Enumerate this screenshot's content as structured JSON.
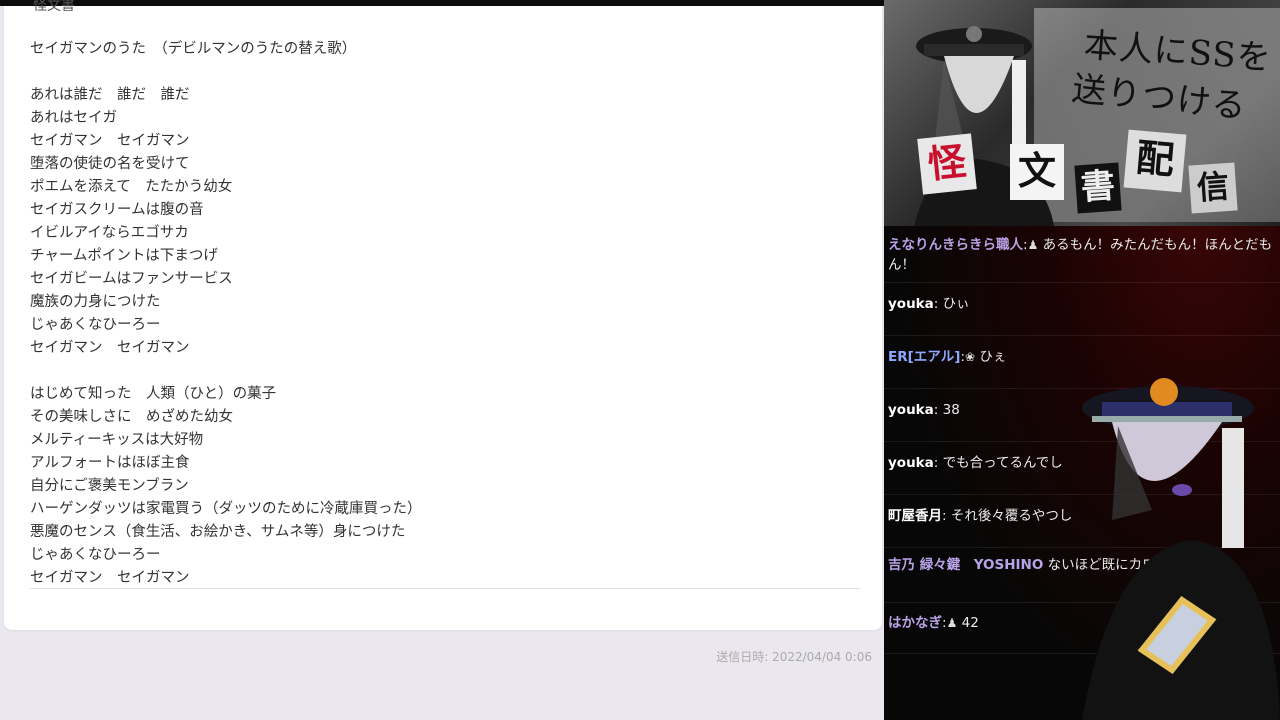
{
  "letter": {
    "clipped_title": "怪文書",
    "lines": [
      "セイガマンのうた　（デビルマンのうたの替え歌）",
      "",
      "あれは誰だ　誰だ　誰だ",
      "あれはセイガ",
      "セイガマン　セイガマン",
      "堕落の使徒の名を受けて",
      "ポエムを添えて　たたかう幼女",
      "セイガスクリームは腹の音",
      "イビルアイならエゴサカ",
      "チャームポイントは下まつげ",
      "セイガビームはファンサービス",
      "魔族の力身につけた",
      "じゃあくなひーろー",
      "セイガマン　セイガマン",
      "",
      "はじめて知った　人類（ひと）の菓子",
      "その美味しさに　めざめた幼女",
      "メルティーキッスは大好物",
      "アルフォートはほぼ主食",
      "自分にご褒美モンブラン",
      "ハーゲンダッツは家電買う（ダッツのために冷蔵庫買った）",
      "悪魔のセンス（食生活、お絵かき、サムネ等）身につけた",
      "じゃあくなひーろー",
      "セイガマン　セイガマン"
    ],
    "sent_date": "送信日時: 2022/04/04 0:06"
  },
  "banner": {
    "text_line1": "本人にSSを",
    "text_line2": "送りつける",
    "keywords": [
      "怪",
      "文",
      "書",
      "配",
      "信"
    ],
    "colors": {
      "accent_red": "#c8102e"
    }
  },
  "chat": {
    "messages": [
      {
        "name": "えなりんきらきら職人",
        "sep": ":",
        "icon": "♟",
        "text": "あるもん！みたんだもん！ほんとだもん！",
        "name_color": "#b9a3e8"
      },
      {
        "name": "youka",
        "sep": ":",
        "icon": "",
        "text": "ひぃ",
        "name_color": "#ffffff"
      },
      {
        "name": "ER[エアル]",
        "sep": ":",
        "icon": "❀",
        "text": "ひぇ",
        "name_color": "#8fa8ff"
      },
      {
        "name": "youka",
        "sep": ":",
        "icon": "",
        "text": "38",
        "name_color": "#ffffff"
      },
      {
        "name": "youka",
        "sep": ":",
        "icon": "",
        "text": "でも合ってるんでし",
        "name_color": "#ffffff"
      },
      {
        "name": "町屋香月",
        "sep": ":",
        "icon": "",
        "text": "それ後々覆るやつし",
        "name_color": "#ffffff"
      },
      {
        "name": "吉乃 緑々鍵　YOSHINO",
        "sep": "",
        "icon": "",
        "text": "ないほど既にカロリー",
        "name_color": "#b9a3e8"
      },
      {
        "name": "はかなぎ",
        "sep": ":",
        "icon": "♟",
        "text": "42",
        "name_color": "#b9a3e8"
      }
    ]
  },
  "icons": {
    "chess_pawn": "chess-pawn-icon",
    "flower": "flower-icon"
  }
}
